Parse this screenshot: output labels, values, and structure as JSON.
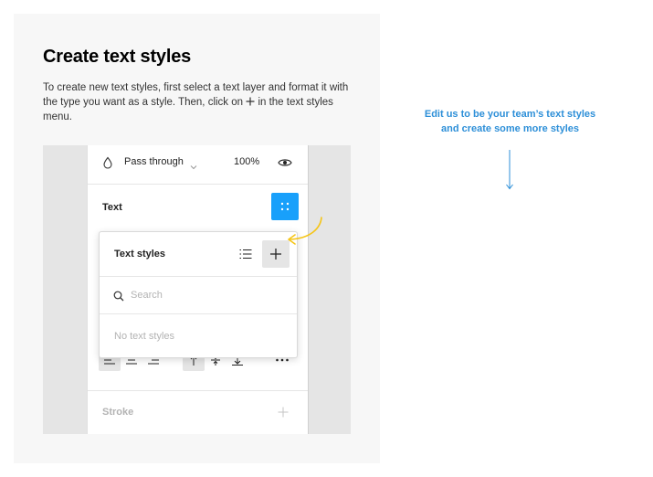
{
  "instructions": {
    "title": "Create text styles",
    "desc_part1": "To create new text styles, first select a text layer and format it with the type you want as a style. Then, click on ",
    "desc_part2": " in the text styles menu."
  },
  "properties_panel": {
    "blend_mode": "Pass through",
    "opacity": "100%",
    "text_section_label": "Text",
    "stroke_section_label": "Stroke"
  },
  "text_styles_popover": {
    "title": "Text styles",
    "search_placeholder": "Search",
    "search_value": "",
    "empty_message": "No text styles"
  },
  "note": {
    "line1": "Edit us to be your team’s text styles",
    "line2": "and create some more styles"
  },
  "colors": {
    "accent_blue": "#18a0fb",
    "note_blue": "#2d8fd8",
    "arrow_yellow": "#f5c518"
  },
  "icons": [
    "drop-icon",
    "chevron-down-icon",
    "eye-icon",
    "grid-dots-icon",
    "list-icon",
    "plus-icon",
    "search-icon",
    "align-left-icon",
    "align-center-icon",
    "align-right-icon",
    "align-top-icon",
    "align-middle-icon",
    "align-bottom-icon",
    "more-icon",
    "curved-arrow-icon",
    "down-arrow-icon"
  ]
}
